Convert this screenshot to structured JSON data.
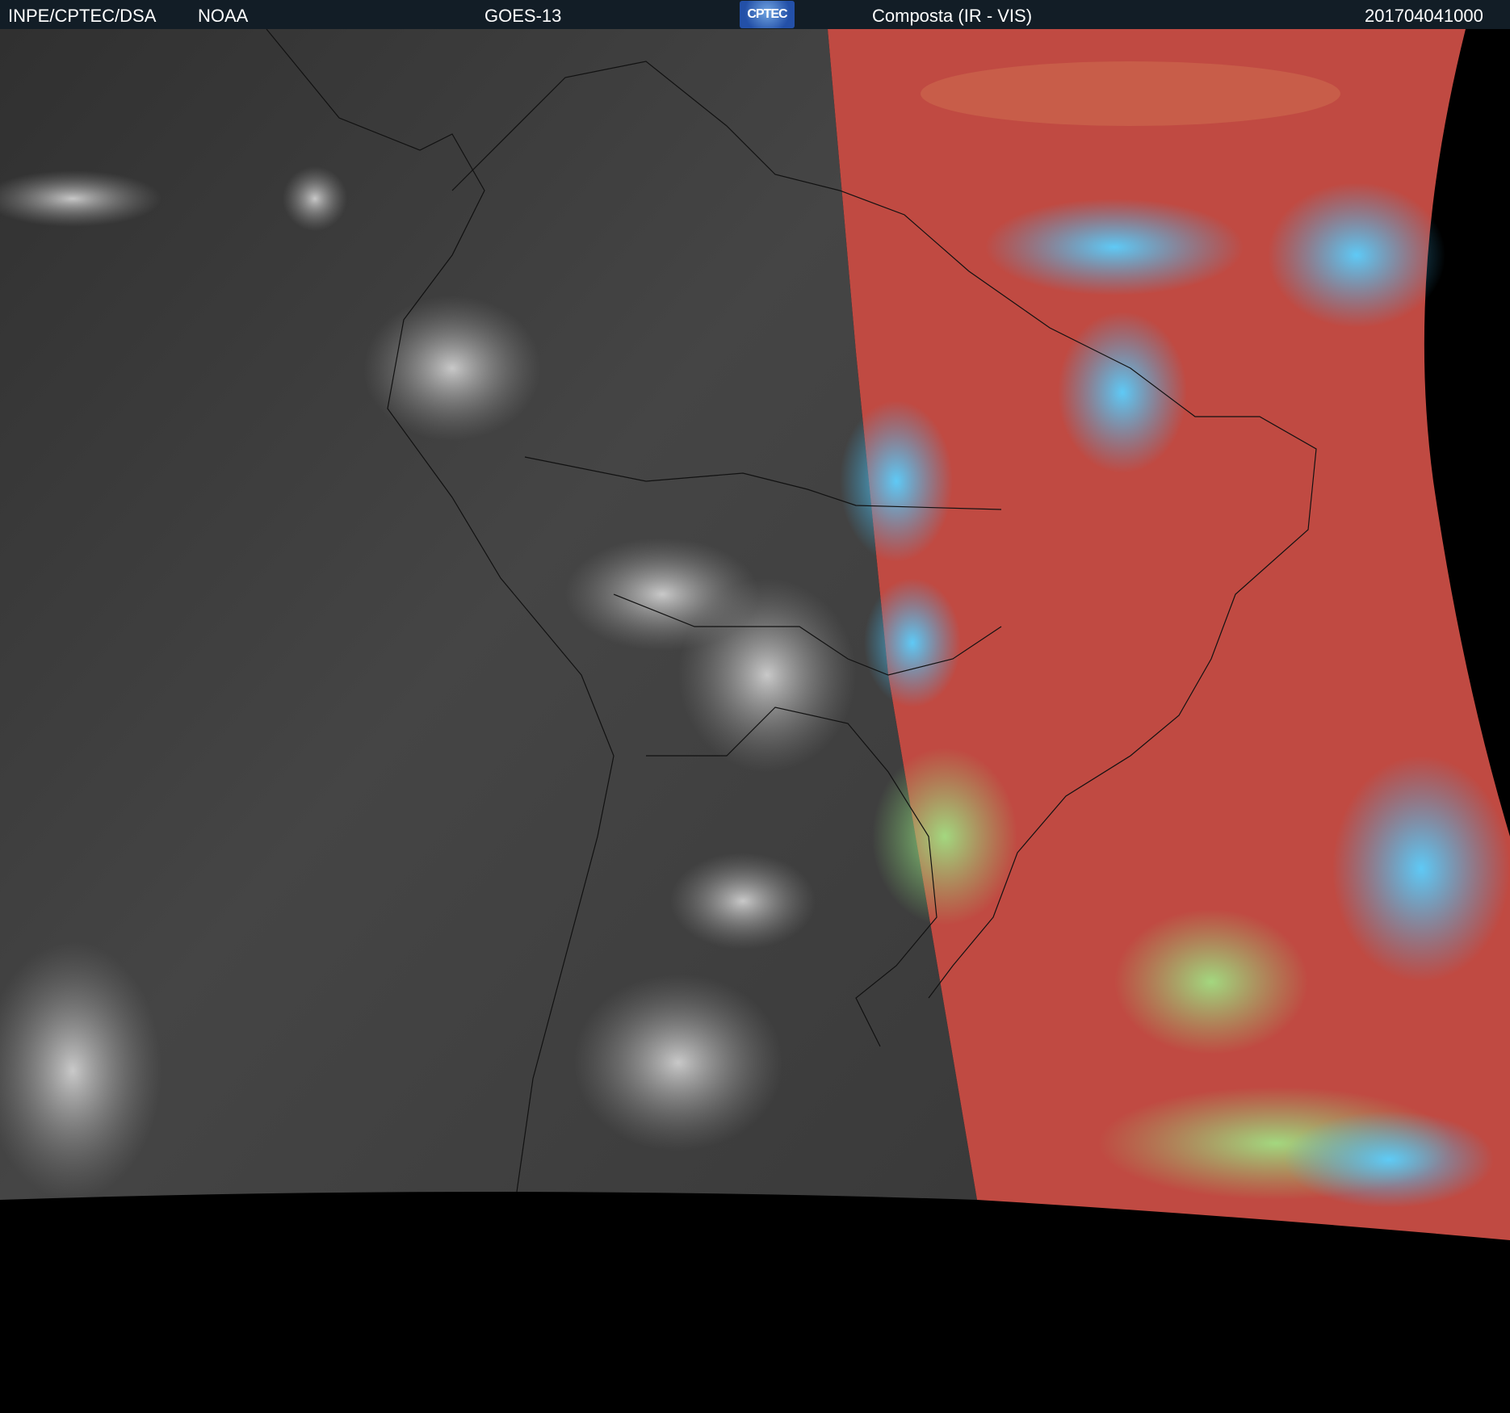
{
  "header": {
    "source": "INPE/CPTEC/DSA",
    "agency": "NOAA",
    "satellite": "GOES-13",
    "logo_text": "CPTEC",
    "product": "Composta (IR - VIS)",
    "timestamp": "201704041000"
  },
  "colors": {
    "header_bg": "#121d26",
    "ir_gray": "#3a3a3a",
    "vis_red": "#c04a42",
    "cloud_blue": "#3ab8f0",
    "cloud_green": "#8ce07a"
  }
}
